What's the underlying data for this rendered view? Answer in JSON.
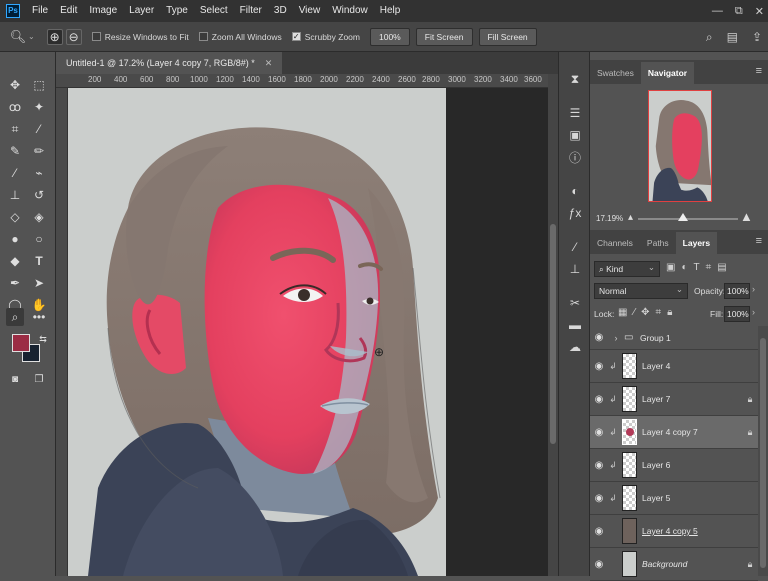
{
  "menubar": {
    "logo": "Ps",
    "items": [
      "File",
      "Edit",
      "Image",
      "Layer",
      "Type",
      "Select",
      "Filter",
      "3D",
      "View",
      "Window",
      "Help"
    ],
    "controls": [
      "—",
      "⧉",
      "✕"
    ]
  },
  "options": {
    "resize_windows": "Resize Windows to Fit",
    "zoom_all": "Zoom All Windows",
    "scrubby_zoom": "Scrubby Zoom",
    "zoom_percent": "100%",
    "fit_screen": "Fit Screen",
    "fill_screen": "Fill Screen"
  },
  "document": {
    "tab_title": "Untitled-1 @ 17.2% (Layer 4 copy 7, RGB/8#) *",
    "ruler_marks": [
      "200",
      "400",
      "600",
      "800",
      "1000",
      "1200",
      "1400",
      "1600",
      "1800",
      "2000",
      "2200",
      "2400",
      "2600",
      "2800",
      "3000",
      "3200",
      "3400",
      "3600"
    ]
  },
  "navigator": {
    "tab_swatches": "Swatches",
    "tab_navigator": "Navigator",
    "zoom": "17.19%"
  },
  "layers_panel": {
    "tab_channels": "Channels",
    "tab_paths": "Paths",
    "tab_layers": "Layers",
    "kind": "Kind",
    "blend_mode": "Normal",
    "opacity_label": "Opacity:",
    "opacity_value": "100%",
    "lock_label": "Lock:",
    "fill_label": "Fill:",
    "fill_value": "100%",
    "layers": [
      {
        "name": "Group 1"
      },
      {
        "name": "Layer 4"
      },
      {
        "name": "Layer 7"
      },
      {
        "name": "Layer 4 copy 7"
      },
      {
        "name": "Layer 6"
      },
      {
        "name": "Layer 5"
      },
      {
        "name": "Layer 4 copy 5"
      },
      {
        "name": "Background"
      }
    ]
  },
  "colors": {
    "foreground": "#9b2c44",
    "background": "#182230"
  }
}
